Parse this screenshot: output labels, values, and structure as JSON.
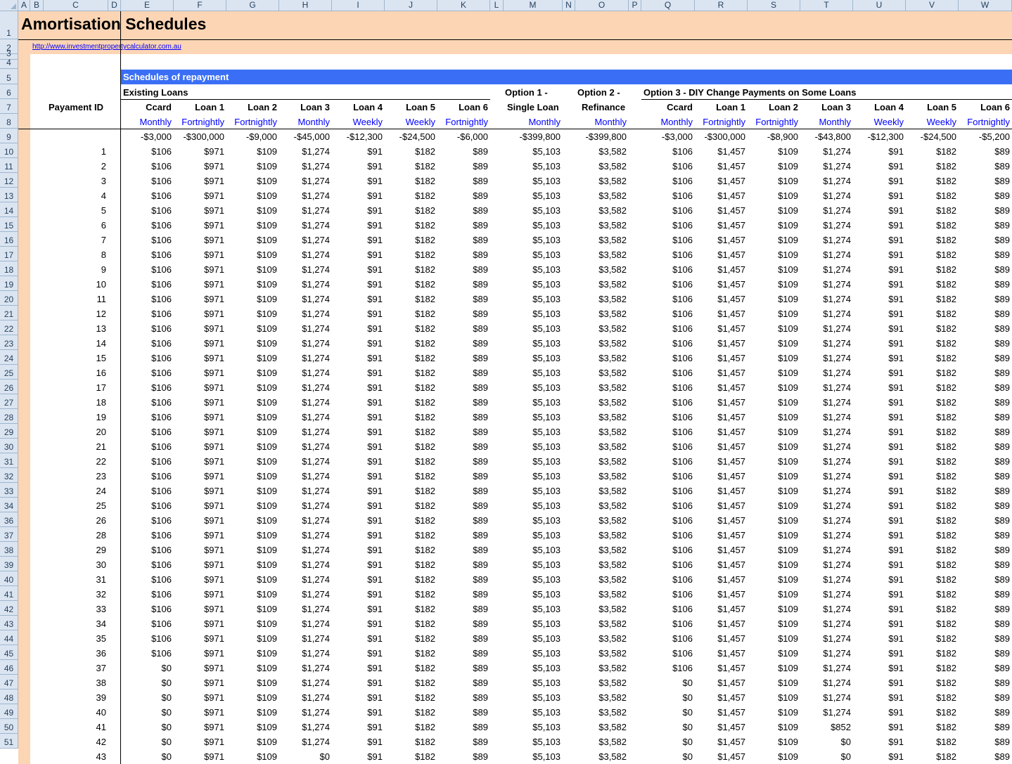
{
  "columns": [
    "A",
    "B",
    "C",
    "D",
    "E",
    "F",
    "G",
    "H",
    "I",
    "J",
    "K",
    "L",
    "M",
    "N",
    "O",
    "P",
    "Q",
    "R",
    "S",
    "T",
    "U",
    "V",
    "W"
  ],
  "title": "Amortisation Schedules",
  "link": "http://www.investmentpropertycalculator.com.au",
  "section_title": "Schedules of repayment",
  "groups": {
    "existing": "Existing Loans",
    "opt1_line1": "Option 1 -",
    "opt1_line2": "Single Loan",
    "opt2_line1": "Option 2 -",
    "opt2_line2": "Refinance",
    "opt3": "Option 3 - DIY Change Payments on Some Loans"
  },
  "payment_id_label": "Payament ID",
  "headers": [
    "Ccard",
    "Loan 1",
    "Loan 2",
    "Loan 3",
    "Loan 4",
    "Loan 5",
    "Loan 6",
    "",
    "",
    "Ccard",
    "Loan 1",
    "Loan 2",
    "Loan 3",
    "Loan 4",
    "Loan 5",
    "Loan 6"
  ],
  "frequencies": [
    "Monthly",
    "Fortnightly",
    "Fortnightly",
    "Monthly",
    "Weekly",
    "Weekly",
    "Fortnightly",
    "Monthly",
    "Monthly",
    "Monthly",
    "Fortnightly",
    "Fortnightly",
    "Monthly",
    "Weekly",
    "Weekly",
    "Fortnightly"
  ],
  "balances": [
    "-$3,000",
    "-$300,000",
    "-$9,000",
    "-$45,000",
    "-$12,300",
    "-$24,500",
    "-$6,000",
    "-$399,800",
    "-$399,800",
    "-$3,000",
    "-$300,000",
    "-$8,900",
    "-$43,800",
    "-$12,300",
    "-$24,500",
    "-$5,200"
  ],
  "row_numbers": [
    "1",
    "2",
    "3",
    "4",
    "5",
    "6",
    "7",
    "8",
    "9",
    "10",
    "11",
    "12",
    "13",
    "14",
    "15",
    "16",
    "17",
    "18",
    "19",
    "20",
    "21",
    "22",
    "23",
    "24",
    "25",
    "26",
    "27",
    "28",
    "29",
    "30",
    "31",
    "32",
    "33",
    "34",
    "36",
    "37",
    "38",
    "39",
    "40",
    "41",
    "42",
    "43",
    "44",
    "45",
    "46",
    "47",
    "48",
    "49",
    "50",
    "51"
  ],
  "rows": [
    {
      "id": "1",
      "v": [
        "$106",
        "$971",
        "$109",
        "$1,274",
        "$91",
        "$182",
        "$89",
        "$5,103",
        "$3,582",
        "$106",
        "$1,457",
        "$109",
        "$1,274",
        "$91",
        "$182",
        "$89"
      ]
    },
    {
      "id": "2",
      "v": [
        "$106",
        "$971",
        "$109",
        "$1,274",
        "$91",
        "$182",
        "$89",
        "$5,103",
        "$3,582",
        "$106",
        "$1,457",
        "$109",
        "$1,274",
        "$91",
        "$182",
        "$89"
      ]
    },
    {
      "id": "3",
      "v": [
        "$106",
        "$971",
        "$109",
        "$1,274",
        "$91",
        "$182",
        "$89",
        "$5,103",
        "$3,582",
        "$106",
        "$1,457",
        "$109",
        "$1,274",
        "$91",
        "$182",
        "$89"
      ]
    },
    {
      "id": "4",
      "v": [
        "$106",
        "$971",
        "$109",
        "$1,274",
        "$91",
        "$182",
        "$89",
        "$5,103",
        "$3,582",
        "$106",
        "$1,457",
        "$109",
        "$1,274",
        "$91",
        "$182",
        "$89"
      ]
    },
    {
      "id": "5",
      "v": [
        "$106",
        "$971",
        "$109",
        "$1,274",
        "$91",
        "$182",
        "$89",
        "$5,103",
        "$3,582",
        "$106",
        "$1,457",
        "$109",
        "$1,274",
        "$91",
        "$182",
        "$89"
      ]
    },
    {
      "id": "6",
      "v": [
        "$106",
        "$971",
        "$109",
        "$1,274",
        "$91",
        "$182",
        "$89",
        "$5,103",
        "$3,582",
        "$106",
        "$1,457",
        "$109",
        "$1,274",
        "$91",
        "$182",
        "$89"
      ]
    },
    {
      "id": "7",
      "v": [
        "$106",
        "$971",
        "$109",
        "$1,274",
        "$91",
        "$182",
        "$89",
        "$5,103",
        "$3,582",
        "$106",
        "$1,457",
        "$109",
        "$1,274",
        "$91",
        "$182",
        "$89"
      ]
    },
    {
      "id": "8",
      "v": [
        "$106",
        "$971",
        "$109",
        "$1,274",
        "$91",
        "$182",
        "$89",
        "$5,103",
        "$3,582",
        "$106",
        "$1,457",
        "$109",
        "$1,274",
        "$91",
        "$182",
        "$89"
      ]
    },
    {
      "id": "9",
      "v": [
        "$106",
        "$971",
        "$109",
        "$1,274",
        "$91",
        "$182",
        "$89",
        "$5,103",
        "$3,582",
        "$106",
        "$1,457",
        "$109",
        "$1,274",
        "$91",
        "$182",
        "$89"
      ]
    },
    {
      "id": "10",
      "v": [
        "$106",
        "$971",
        "$109",
        "$1,274",
        "$91",
        "$182",
        "$89",
        "$5,103",
        "$3,582",
        "$106",
        "$1,457",
        "$109",
        "$1,274",
        "$91",
        "$182",
        "$89"
      ]
    },
    {
      "id": "11",
      "v": [
        "$106",
        "$971",
        "$109",
        "$1,274",
        "$91",
        "$182",
        "$89",
        "$5,103",
        "$3,582",
        "$106",
        "$1,457",
        "$109",
        "$1,274",
        "$91",
        "$182",
        "$89"
      ]
    },
    {
      "id": "12",
      "v": [
        "$106",
        "$971",
        "$109",
        "$1,274",
        "$91",
        "$182",
        "$89",
        "$5,103",
        "$3,582",
        "$106",
        "$1,457",
        "$109",
        "$1,274",
        "$91",
        "$182",
        "$89"
      ]
    },
    {
      "id": "13",
      "v": [
        "$106",
        "$971",
        "$109",
        "$1,274",
        "$91",
        "$182",
        "$89",
        "$5,103",
        "$3,582",
        "$106",
        "$1,457",
        "$109",
        "$1,274",
        "$91",
        "$182",
        "$89"
      ]
    },
    {
      "id": "14",
      "v": [
        "$106",
        "$971",
        "$109",
        "$1,274",
        "$91",
        "$182",
        "$89",
        "$5,103",
        "$3,582",
        "$106",
        "$1,457",
        "$109",
        "$1,274",
        "$91",
        "$182",
        "$89"
      ]
    },
    {
      "id": "15",
      "v": [
        "$106",
        "$971",
        "$109",
        "$1,274",
        "$91",
        "$182",
        "$89",
        "$5,103",
        "$3,582",
        "$106",
        "$1,457",
        "$109",
        "$1,274",
        "$91",
        "$182",
        "$89"
      ]
    },
    {
      "id": "16",
      "v": [
        "$106",
        "$971",
        "$109",
        "$1,274",
        "$91",
        "$182",
        "$89",
        "$5,103",
        "$3,582",
        "$106",
        "$1,457",
        "$109",
        "$1,274",
        "$91",
        "$182",
        "$89"
      ]
    },
    {
      "id": "17",
      "v": [
        "$106",
        "$971",
        "$109",
        "$1,274",
        "$91",
        "$182",
        "$89",
        "$5,103",
        "$3,582",
        "$106",
        "$1,457",
        "$109",
        "$1,274",
        "$91",
        "$182",
        "$89"
      ]
    },
    {
      "id": "18",
      "v": [
        "$106",
        "$971",
        "$109",
        "$1,274",
        "$91",
        "$182",
        "$89",
        "$5,103",
        "$3,582",
        "$106",
        "$1,457",
        "$109",
        "$1,274",
        "$91",
        "$182",
        "$89"
      ]
    },
    {
      "id": "19",
      "v": [
        "$106",
        "$971",
        "$109",
        "$1,274",
        "$91",
        "$182",
        "$89",
        "$5,103",
        "$3,582",
        "$106",
        "$1,457",
        "$109",
        "$1,274",
        "$91",
        "$182",
        "$89"
      ]
    },
    {
      "id": "20",
      "v": [
        "$106",
        "$971",
        "$109",
        "$1,274",
        "$91",
        "$182",
        "$89",
        "$5,103",
        "$3,582",
        "$106",
        "$1,457",
        "$109",
        "$1,274",
        "$91",
        "$182",
        "$89"
      ]
    },
    {
      "id": "21",
      "v": [
        "$106",
        "$971",
        "$109",
        "$1,274",
        "$91",
        "$182",
        "$89",
        "$5,103",
        "$3,582",
        "$106",
        "$1,457",
        "$109",
        "$1,274",
        "$91",
        "$182",
        "$89"
      ]
    },
    {
      "id": "22",
      "v": [
        "$106",
        "$971",
        "$109",
        "$1,274",
        "$91",
        "$182",
        "$89",
        "$5,103",
        "$3,582",
        "$106",
        "$1,457",
        "$109",
        "$1,274",
        "$91",
        "$182",
        "$89"
      ]
    },
    {
      "id": "23",
      "v": [
        "$106",
        "$971",
        "$109",
        "$1,274",
        "$91",
        "$182",
        "$89",
        "$5,103",
        "$3,582",
        "$106",
        "$1,457",
        "$109",
        "$1,274",
        "$91",
        "$182",
        "$89"
      ]
    },
    {
      "id": "24",
      "v": [
        "$106",
        "$971",
        "$109",
        "$1,274",
        "$91",
        "$182",
        "$89",
        "$5,103",
        "$3,582",
        "$106",
        "$1,457",
        "$109",
        "$1,274",
        "$91",
        "$182",
        "$89"
      ]
    },
    {
      "id": "25",
      "v": [
        "$106",
        "$971",
        "$109",
        "$1,274",
        "$91",
        "$182",
        "$89",
        "$5,103",
        "$3,582",
        "$106",
        "$1,457",
        "$109",
        "$1,274",
        "$91",
        "$182",
        "$89"
      ]
    },
    {
      "id": "26",
      "v": [
        "$106",
        "$971",
        "$109",
        "$1,274",
        "$91",
        "$182",
        "$89",
        "$5,103",
        "$3,582",
        "$106",
        "$1,457",
        "$109",
        "$1,274",
        "$91",
        "$182",
        "$89"
      ]
    },
    {
      "id": "28",
      "v": [
        "$106",
        "$971",
        "$109",
        "$1,274",
        "$91",
        "$182",
        "$89",
        "$5,103",
        "$3,582",
        "$106",
        "$1,457",
        "$109",
        "$1,274",
        "$91",
        "$182",
        "$89"
      ]
    },
    {
      "id": "29",
      "v": [
        "$106",
        "$971",
        "$109",
        "$1,274",
        "$91",
        "$182",
        "$89",
        "$5,103",
        "$3,582",
        "$106",
        "$1,457",
        "$109",
        "$1,274",
        "$91",
        "$182",
        "$89"
      ]
    },
    {
      "id": "30",
      "v": [
        "$106",
        "$971",
        "$109",
        "$1,274",
        "$91",
        "$182",
        "$89",
        "$5,103",
        "$3,582",
        "$106",
        "$1,457",
        "$109",
        "$1,274",
        "$91",
        "$182",
        "$89"
      ]
    },
    {
      "id": "31",
      "v": [
        "$106",
        "$971",
        "$109",
        "$1,274",
        "$91",
        "$182",
        "$89",
        "$5,103",
        "$3,582",
        "$106",
        "$1,457",
        "$109",
        "$1,274",
        "$91",
        "$182",
        "$89"
      ]
    },
    {
      "id": "32",
      "v": [
        "$106",
        "$971",
        "$109",
        "$1,274",
        "$91",
        "$182",
        "$89",
        "$5,103",
        "$3,582",
        "$106",
        "$1,457",
        "$109",
        "$1,274",
        "$91",
        "$182",
        "$89"
      ]
    },
    {
      "id": "33",
      "v": [
        "$106",
        "$971",
        "$109",
        "$1,274",
        "$91",
        "$182",
        "$89",
        "$5,103",
        "$3,582",
        "$106",
        "$1,457",
        "$109",
        "$1,274",
        "$91",
        "$182",
        "$89"
      ]
    },
    {
      "id": "34",
      "v": [
        "$106",
        "$971",
        "$109",
        "$1,274",
        "$91",
        "$182",
        "$89",
        "$5,103",
        "$3,582",
        "$106",
        "$1,457",
        "$109",
        "$1,274",
        "$91",
        "$182",
        "$89"
      ]
    },
    {
      "id": "35",
      "v": [
        "$106",
        "$971",
        "$109",
        "$1,274",
        "$91",
        "$182",
        "$89",
        "$5,103",
        "$3,582",
        "$106",
        "$1,457",
        "$109",
        "$1,274",
        "$91",
        "$182",
        "$89"
      ]
    },
    {
      "id": "36",
      "v": [
        "$106",
        "$971",
        "$109",
        "$1,274",
        "$91",
        "$182",
        "$89",
        "$5,103",
        "$3,582",
        "$106",
        "$1,457",
        "$109",
        "$1,274",
        "$91",
        "$182",
        "$89"
      ]
    },
    {
      "id": "37",
      "v": [
        "$0",
        "$971",
        "$109",
        "$1,274",
        "$91",
        "$182",
        "$89",
        "$5,103",
        "$3,582",
        "$106",
        "$1,457",
        "$109",
        "$1,274",
        "$91",
        "$182",
        "$89"
      ]
    },
    {
      "id": "38",
      "v": [
        "$0",
        "$971",
        "$109",
        "$1,274",
        "$91",
        "$182",
        "$89",
        "$5,103",
        "$3,582",
        "$0",
        "$1,457",
        "$109",
        "$1,274",
        "$91",
        "$182",
        "$89"
      ]
    },
    {
      "id": "39",
      "v": [
        "$0",
        "$971",
        "$109",
        "$1,274",
        "$91",
        "$182",
        "$89",
        "$5,103",
        "$3,582",
        "$0",
        "$1,457",
        "$109",
        "$1,274",
        "$91",
        "$182",
        "$89"
      ]
    },
    {
      "id": "40",
      "v": [
        "$0",
        "$971",
        "$109",
        "$1,274",
        "$91",
        "$182",
        "$89",
        "$5,103",
        "$3,582",
        "$0",
        "$1,457",
        "$109",
        "$1,274",
        "$91",
        "$182",
        "$89"
      ]
    },
    {
      "id": "41",
      "v": [
        "$0",
        "$971",
        "$109",
        "$1,274",
        "$91",
        "$182",
        "$89",
        "$5,103",
        "$3,582",
        "$0",
        "$1,457",
        "$109",
        "$852",
        "$91",
        "$182",
        "$89"
      ]
    },
    {
      "id": "42",
      "v": [
        "$0",
        "$971",
        "$109",
        "$1,274",
        "$91",
        "$182",
        "$89",
        "$5,103",
        "$3,582",
        "$0",
        "$1,457",
        "$109",
        "$0",
        "$91",
        "$182",
        "$89"
      ]
    },
    {
      "id": "43",
      "v": [
        "$0",
        "$971",
        "$109",
        "$0",
        "$91",
        "$182",
        "$89",
        "$5,103",
        "$3,582",
        "$0",
        "$1,457",
        "$109",
        "$0",
        "$91",
        "$182",
        "$89"
      ]
    }
  ],
  "colors": {
    "header_bg": "#dbe5f1",
    "peach": "#fcd5b4",
    "section_bar": "#3a6ff5",
    "link": "#0000ff"
  }
}
